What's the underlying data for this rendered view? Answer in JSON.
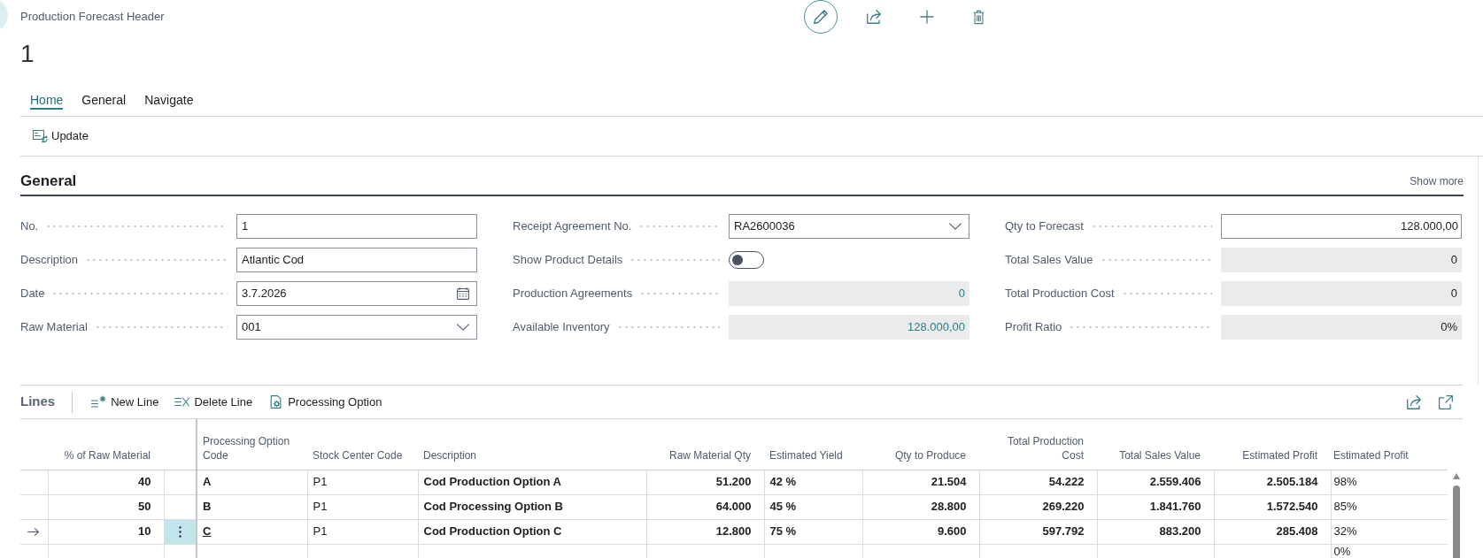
{
  "page": {
    "caption": "Production Forecast Header",
    "title": "1"
  },
  "tabs": [
    {
      "label": "Home",
      "selected": true
    },
    {
      "label": "General",
      "selected": false
    },
    {
      "label": "Navigate",
      "selected": false
    }
  ],
  "actions": [
    {
      "label": "Update"
    }
  ],
  "general": {
    "title": "General",
    "show_more": "Show more",
    "columns": [
      {
        "fields": [
          {
            "label": "No.",
            "kind": "text",
            "value": "1"
          },
          {
            "label": "Description",
            "kind": "text",
            "value": "Atlantic Cod"
          },
          {
            "label": "Date",
            "kind": "date",
            "value": "3.7.2026"
          },
          {
            "label": "Raw Material",
            "kind": "dropdown",
            "value": "001"
          }
        ]
      },
      {
        "fields": [
          {
            "label": "Receipt Agreement No.",
            "kind": "dropdown",
            "value": "RA2600036"
          },
          {
            "label": "Show Product Details",
            "kind": "toggle",
            "on": false
          },
          {
            "label": "Production Agreements",
            "kind": "drilldown",
            "value": "0"
          },
          {
            "label": "Available Inventory",
            "kind": "drilldown",
            "value": "128.000,00"
          }
        ]
      },
      {
        "fields": [
          {
            "label": "Qty to Forecast",
            "kind": "number",
            "value": "128.000,00"
          },
          {
            "label": "Total Sales Value",
            "kind": "readonly",
            "value": "0"
          },
          {
            "label": "Total Production Cost",
            "kind": "readonly",
            "value": "0"
          },
          {
            "label": "Profit Ratio",
            "kind": "readonly",
            "value": "0%"
          }
        ]
      }
    ]
  },
  "lines": {
    "title": "Lines",
    "actions": [
      {
        "label": "New Line"
      },
      {
        "label": "Delete Line"
      },
      {
        "label": "Processing Option"
      }
    ],
    "columns": [
      "% of Raw Material",
      "Processing Option Code",
      "Stock Center Code",
      "Description",
      "Raw Material Qty",
      "Estimated Yield",
      "Qty to Produce",
      "Total Production Cost",
      "Total Sales Value",
      "Estimated Profit",
      "Estimated Profit"
    ],
    "rows": [
      {
        "selected": false,
        "pct_raw_material": "40",
        "processing_option_code": "A",
        "stock_center_code": "P1",
        "description": "Cod Production Option A",
        "raw_material_qty": "51.200",
        "estimated_yield": "42 %",
        "qty_to_produce": "21.504",
        "total_production_cost": "54.222",
        "total_sales_value": "2.559.406",
        "estimated_profit": "2.505.184",
        "estimated_profit_2": "98%"
      },
      {
        "selected": false,
        "pct_raw_material": "50",
        "processing_option_code": "B",
        "stock_center_code": "P1",
        "description": "Cod Processing Option B",
        "raw_material_qty": "64.000",
        "estimated_yield": "45 %",
        "qty_to_produce": "28.800",
        "total_production_cost": "269.220",
        "total_sales_value": "1.841.760",
        "estimated_profit": "1.572.540",
        "estimated_profit_2": "85%"
      },
      {
        "selected": true,
        "pct_raw_material": "10",
        "processing_option_code": "C",
        "stock_center_code": "P1",
        "description": "Cod Production Option C",
        "raw_material_qty": "12.800",
        "estimated_yield": "75 %",
        "qty_to_produce": "9.600",
        "total_production_cost": "597.792",
        "total_sales_value": "883.200",
        "estimated_profit": "285.408",
        "estimated_profit_2": "32%"
      },
      {
        "selected": false,
        "estimated_profit_2": "0%"
      }
    ]
  }
}
